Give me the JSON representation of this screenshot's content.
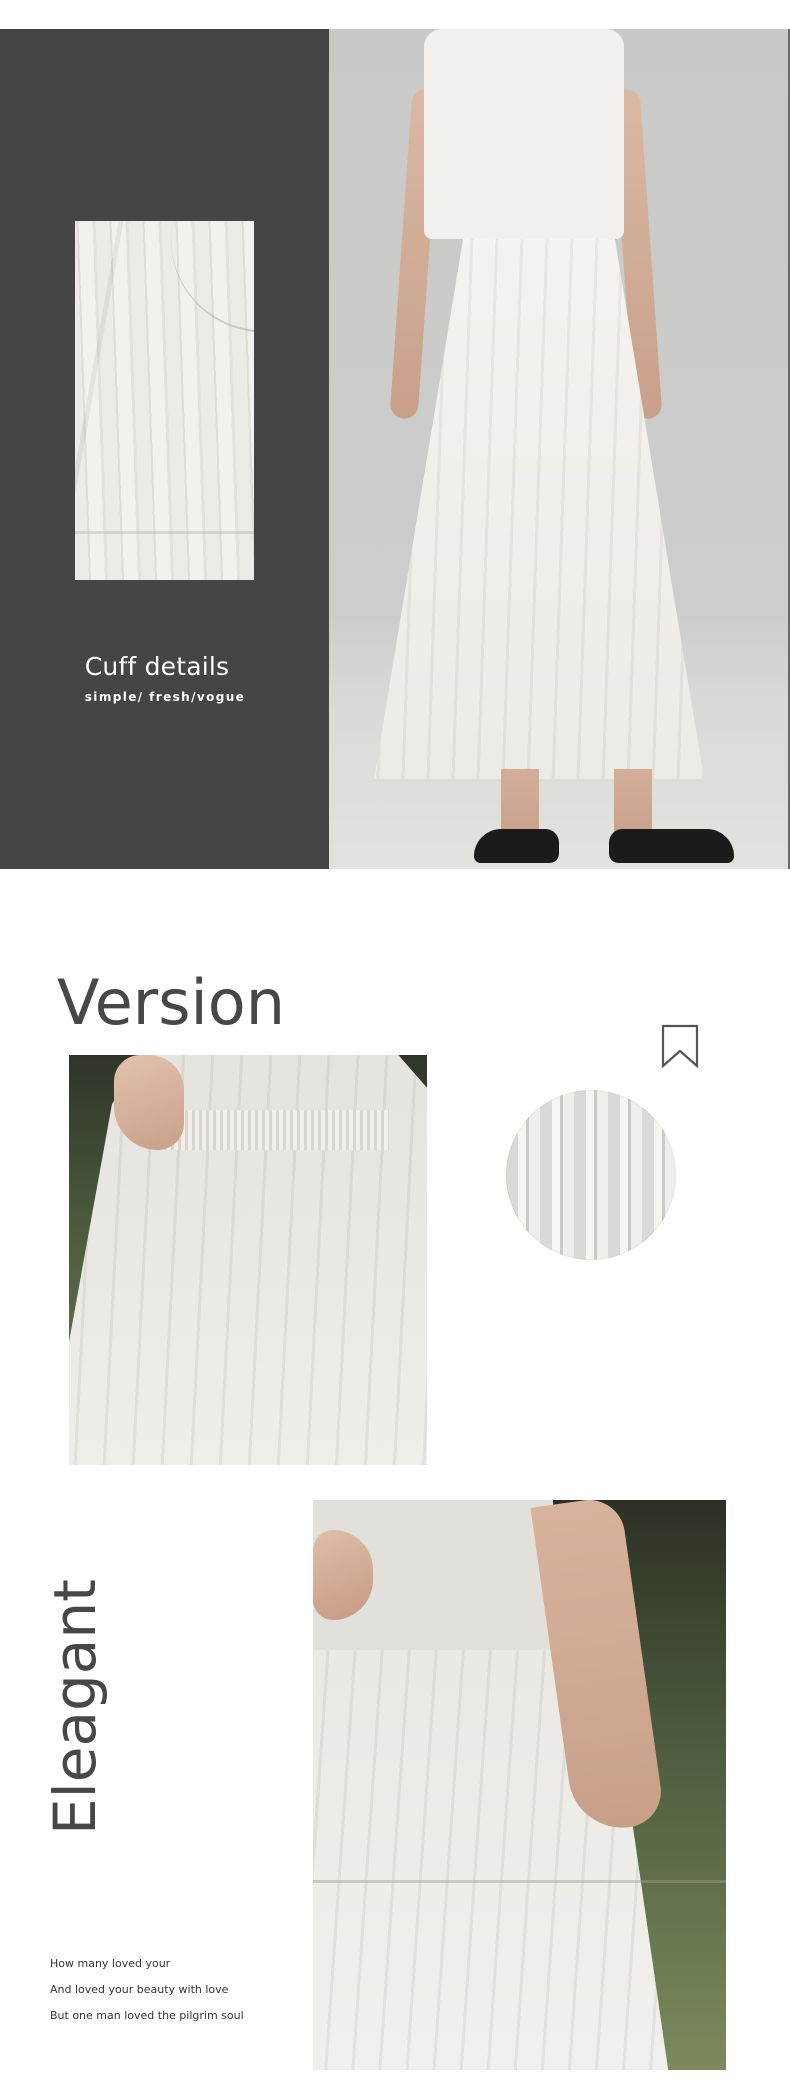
{
  "cuff_section": {
    "title": "Cuff details",
    "subtitle": "simple/ fresh/vogue"
  },
  "version_section": {
    "title": "Version"
  },
  "eleagant_section": {
    "title": "Eleagant",
    "verse_lines": [
      "How many loved your",
      "And loved your beauty with love",
      "But one man loved the pilgrim soul"
    ]
  },
  "colors": {
    "dark_panel": "#454545",
    "heading_gray": "#474747",
    "text_white": "#ffffff"
  },
  "icons": {
    "bookmark": "bookmark-icon"
  }
}
